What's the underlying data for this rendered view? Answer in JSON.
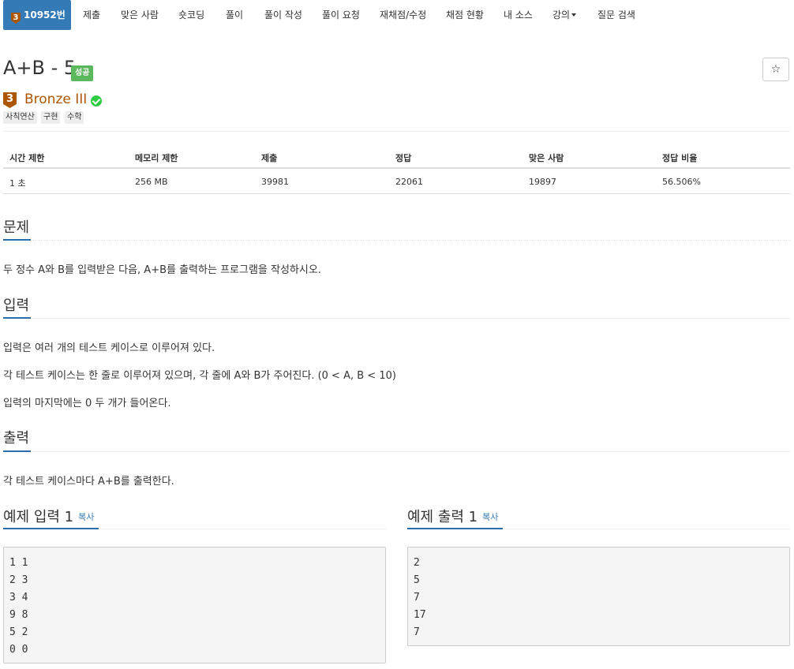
{
  "nav": {
    "problem_tier": "3",
    "tabs": [
      "10952번",
      "제출",
      "맞은 사람",
      "숏코딩",
      "풀이",
      "풀이 작성",
      "풀이 요청",
      "재채점/수정",
      "채점 현황",
      "내 소스",
      "강의",
      "질문 검색"
    ]
  },
  "problem": {
    "title": "A+B - 5",
    "status_badge": "성공",
    "star": "☆",
    "tier_number": "3",
    "tier_name": "Bronze III",
    "tags": [
      "사칙연산",
      "구현",
      "수학"
    ]
  },
  "stats": {
    "headers": [
      "시간 제한",
      "메모리 제한",
      "제출",
      "정답",
      "맞은 사람",
      "정답 비율"
    ],
    "values": [
      "1 초",
      "256 MB",
      "39981",
      "22061",
      "19897",
      "56.506%"
    ]
  },
  "sections": {
    "problem_title": "문제",
    "problem_text": "두 정수 A와 B를 입력받은 다음, A+B를 출력하는 프로그램을 작성하시오.",
    "input_title": "입력",
    "input_lines": [
      "입력은 여러 개의 테스트 케이스로 이루어져 있다.",
      "각 테스트 케이스는 한 줄로 이루어져 있으며, 각 줄에 A와 B가 주어진다. (0 < A, B < 10)",
      "입력의 마지막에는 0 두 개가 들어온다."
    ],
    "output_title": "출력",
    "output_text": "각 테스트 케이스마다 A+B를 출력한다."
  },
  "samples": {
    "input_title": "예제 입력 1",
    "output_title": "예제 출력 1",
    "copy_label": "복사",
    "input_text": "1 1\n2 3\n3 4\n9 8\n5 2\n0 0",
    "output_text": "2\n5\n7\n17\n7"
  }
}
